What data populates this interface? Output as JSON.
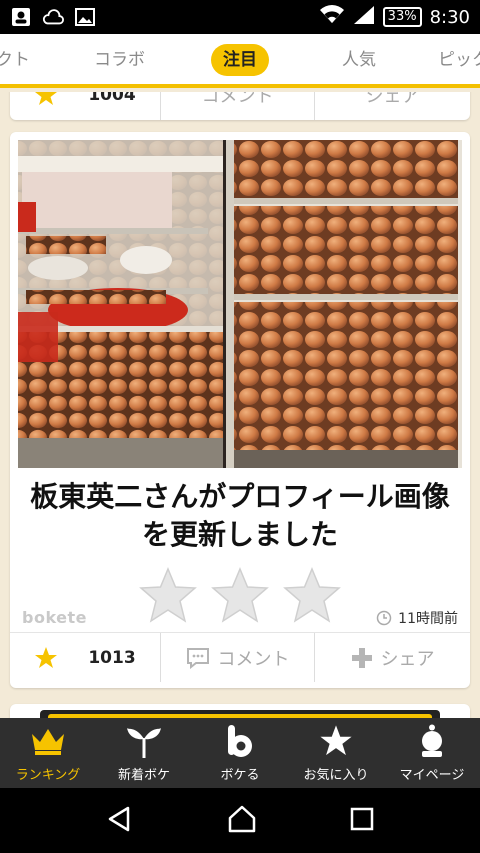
{
  "status_bar": {
    "battery": "33%",
    "time": "8:30"
  },
  "tabs": [
    {
      "label": "クト"
    },
    {
      "label": "コラボ"
    },
    {
      "label": "注目"
    },
    {
      "label": "人気"
    },
    {
      "label": "ピック"
    }
  ],
  "prev_card": {
    "count": "1004",
    "comment_label": "コメント",
    "share_label": "シェア"
  },
  "post": {
    "caption": "板東英二さんがプロフィール画像を更新しました",
    "watermark": "bokete",
    "time_ago": "11時間前",
    "rating_stars": 3,
    "count": "1013",
    "comment_label": "コメント",
    "share_label": "シェア"
  },
  "bottom_nav": [
    {
      "label": "ランキング",
      "icon": "crown-icon"
    },
    {
      "label": "新着ボケ",
      "icon": "sprout-icon"
    },
    {
      "label": "ボケる",
      "icon": "bokete-b-icon"
    },
    {
      "label": "お気に入り",
      "icon": "star-icon"
    },
    {
      "label": "マイページ",
      "icon": "user-icon"
    }
  ],
  "colors": {
    "accent": "#f6c300",
    "nav_bg": "#2f2f2f",
    "page_bg": "#f3ead7"
  }
}
